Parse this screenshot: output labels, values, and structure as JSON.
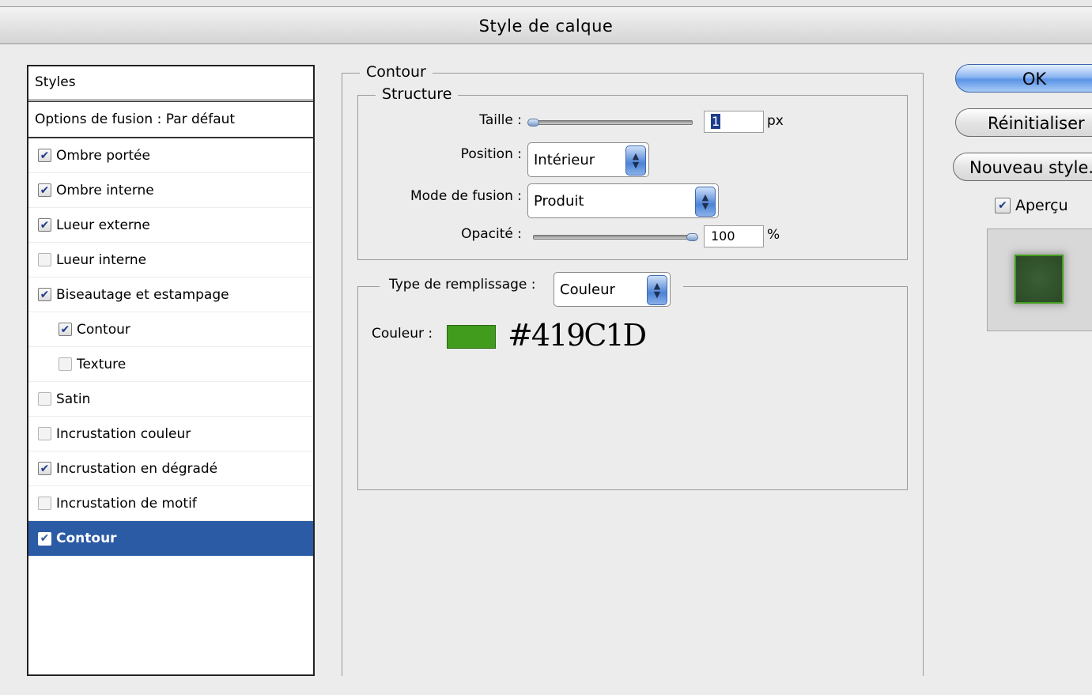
{
  "window": {
    "title": "Style de calque"
  },
  "styles_panel": {
    "header": "Styles",
    "options": "Options de fusion : Par défaut",
    "items": [
      {
        "label": "Ombre portée",
        "checked": true
      },
      {
        "label": "Ombre interne",
        "checked": true
      },
      {
        "label": "Lueur externe",
        "checked": true
      },
      {
        "label": "Lueur interne",
        "checked": false
      },
      {
        "label": "Biseautage et estampage",
        "checked": true
      },
      {
        "label": "Contour",
        "checked": true,
        "indent": true
      },
      {
        "label": "Texture",
        "checked": false,
        "indent": true
      },
      {
        "label": "Satin",
        "checked": false
      },
      {
        "label": "Incrustation couleur",
        "checked": false
      },
      {
        "label": "Incrustation en dégradé",
        "checked": true
      },
      {
        "label": "Incrustation de motif",
        "checked": false
      },
      {
        "label": "Contour",
        "checked": true,
        "selected": true
      }
    ]
  },
  "contour": {
    "title": "Contour",
    "structure": {
      "title": "Structure",
      "taille_label": "Taille :",
      "taille_value": "1",
      "taille_unit": "px",
      "position_label": "Position :",
      "position_value": "Intérieur",
      "mode_label": "Mode de fusion :",
      "mode_value": "Produit",
      "opacite_label": "Opacité :",
      "opacite_value": "100",
      "opacite_unit": "%"
    },
    "fill": {
      "type_label": "Type de remplissage :",
      "type_value": "Couleur",
      "couleur_label": "Couleur :",
      "color_hex": "#419C1D"
    }
  },
  "buttons": {
    "ok": "OK",
    "reset": "Réinitialiser",
    "new_style": "Nouveau style...",
    "preview_label": "Aperçu",
    "preview_checked": true
  },
  "colors": {
    "accent": "#2c5ba5",
    "swatch": "#419c1d"
  }
}
